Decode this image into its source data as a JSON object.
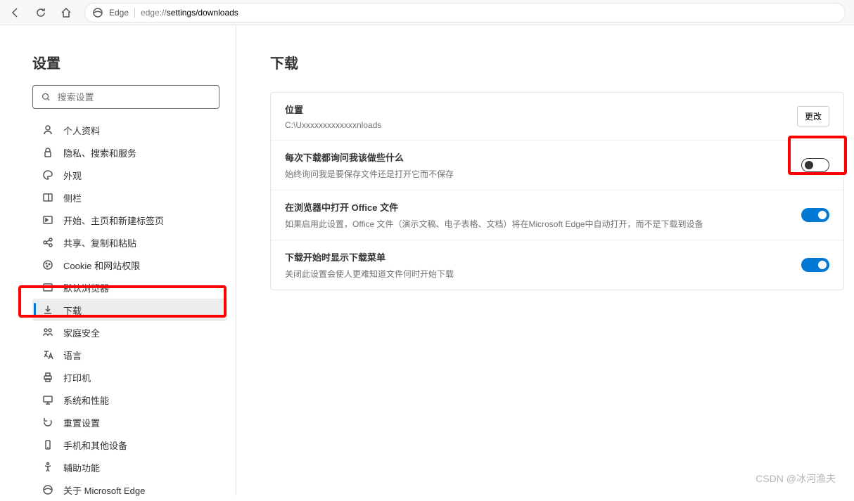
{
  "toolbar": {
    "addr_label": "Edge",
    "addr_prefix": "edge://",
    "addr_suffix": "settings/downloads"
  },
  "sidebar": {
    "title": "设置",
    "search_placeholder": "搜索设置",
    "items": [
      {
        "label": "个人资料"
      },
      {
        "label": "隐私、搜索和服务"
      },
      {
        "label": "外观"
      },
      {
        "label": "侧栏"
      },
      {
        "label": "开始、主页和新建标签页"
      },
      {
        "label": "共享、复制和粘贴"
      },
      {
        "label": "Cookie 和网站权限"
      },
      {
        "label": "默认浏览器"
      },
      {
        "label": "下载"
      },
      {
        "label": "家庭安全"
      },
      {
        "label": "语言"
      },
      {
        "label": "打印机"
      },
      {
        "label": "系统和性能"
      },
      {
        "label": "重置设置"
      },
      {
        "label": "手机和其他设备"
      },
      {
        "label": "辅助功能"
      },
      {
        "label": "关于 Microsoft Edge"
      }
    ]
  },
  "main": {
    "title": "下载",
    "location": {
      "title": "位置",
      "path": "C:\\Uxxxxxxxxxxxxxnloads",
      "change": "更改"
    },
    "ask": {
      "title": "每次下载都询问我该做些什么",
      "desc": "始终询问我是要保存文件还是打开它而不保存"
    },
    "office": {
      "title": "在浏览器中打开 Office 文件",
      "desc": "如果启用此设置，Office 文件（演示文稿、电子表格、文档）将在Microsoft Edge中自动打开，而不是下载到设备"
    },
    "menu": {
      "title": "下载开始时显示下载菜单",
      "desc": "关闭此设置会使人更难知道文件何时开始下载"
    }
  },
  "watermark": "CSDN @冰河渔夫"
}
